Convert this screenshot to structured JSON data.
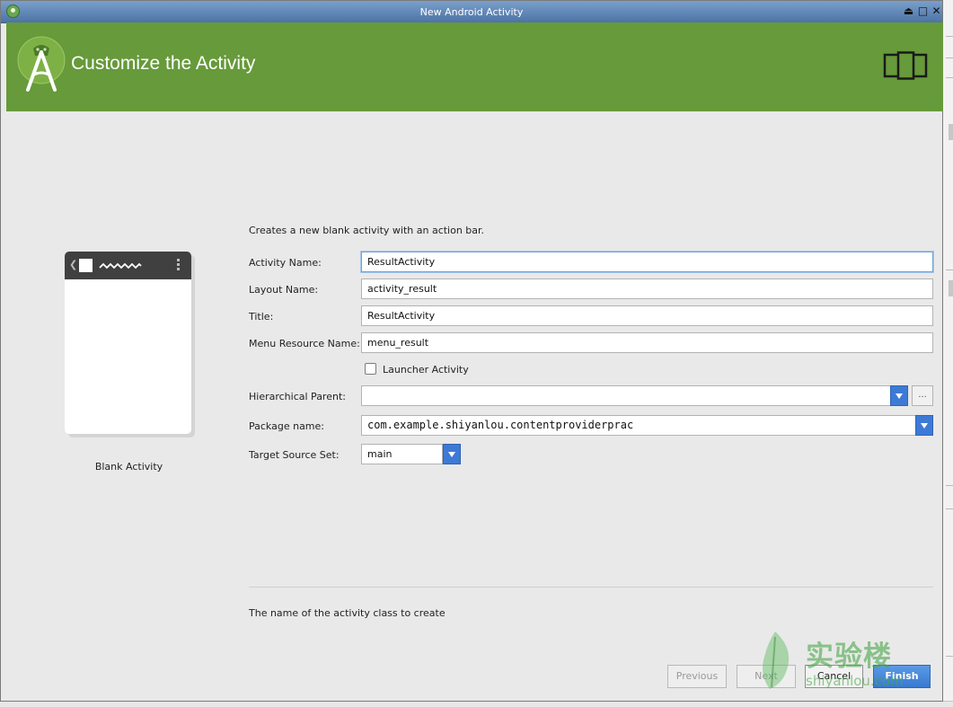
{
  "window": {
    "title": "New Android Activity"
  },
  "header": {
    "title": "Customize the Activity"
  },
  "template_preview": {
    "caption": "Blank Activity"
  },
  "form": {
    "description": "Creates a new blank activity with an action bar.",
    "activity_name": {
      "label": "Activity Name:",
      "value": "ResultActivity"
    },
    "layout_name": {
      "label": "Layout Name:",
      "value": "activity_result"
    },
    "title": {
      "label": "Title:",
      "value": "ResultActivity"
    },
    "menu_resource_name": {
      "label": "Menu Resource Name:",
      "value": "menu_result"
    },
    "launcher_activity": {
      "label": "Launcher Activity",
      "checked": false
    },
    "hierarchical_parent": {
      "label": "Hierarchical Parent:",
      "value": "",
      "browse_label": "..."
    },
    "package_name": {
      "label": "Package name:",
      "value": "com.example.shiyanlou.contentproviderprac"
    },
    "target_source_set": {
      "label": "Target Source Set:",
      "value": "main"
    }
  },
  "hint": "The name of the activity class to create",
  "buttons": {
    "previous": "Previous",
    "next": "Next",
    "cancel": "Cancel",
    "finish": "Finish"
  },
  "watermark": {
    "cn": "实验楼",
    "en": "shiyanlou.com"
  },
  "colors": {
    "banner": "#669a3a",
    "titlebar": "#4c73a6",
    "accent_button": "#3d7ad6"
  }
}
